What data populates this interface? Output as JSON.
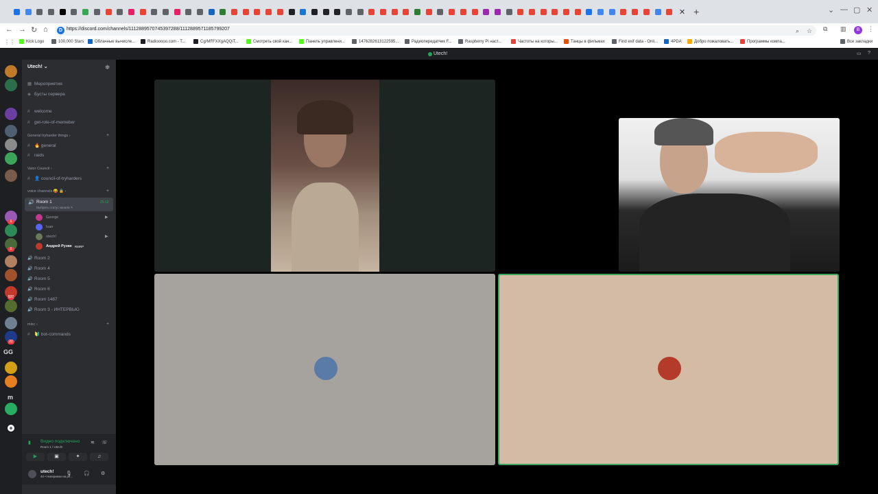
{
  "browser": {
    "url": "https://discord.com/channels/1112889570745397288/1112889571185799207",
    "omnibox_icon_letter": "D",
    "profile_letter": "B",
    "tab_icon_colors": [
      "#1a73e8",
      "#4285f4",
      "#5f6368",
      "#5f6368",
      "#000000",
      "#5f6368",
      "#34a853",
      "#5f6368",
      "#ea4335",
      "#5f6368",
      "#e91e63",
      "#ea4335",
      "#5f6368",
      "#5f6368",
      "#e91e63",
      "#5f6368",
      "#5f6368",
      "#1565c0",
      "#2e7d32",
      "#ea4335",
      "#ea4335",
      "#ea4335",
      "#ea4335",
      "#ea4335",
      "#202124",
      "#1976d2",
      "#202124",
      "#202124",
      "#202124",
      "#5f6368",
      "#5f6368",
      "#ea4335",
      "#ea4335",
      "#ea4335",
      "#ea4335",
      "#2e7d32",
      "#ea4335",
      "#5f6368",
      "#ea4335",
      "#ea4335",
      "#ea4335",
      "#9c27b0",
      "#9c27b0",
      "#5f6368",
      "#ea4335",
      "#ea4335",
      "#ea4335",
      "#ea4335",
      "#ea4335",
      "#ea4335",
      "#1a73e8",
      "#4285f4",
      "#4285f4",
      "#ea4335",
      "#ea4335",
      "#ea4335",
      "#4285f4",
      "#ea4335"
    ],
    "bookmarks": [
      {
        "label": "Kick Logo",
        "color": "#53fc18"
      },
      {
        "label": "100,000 Stars",
        "color": "#5f6368"
      },
      {
        "label": "Облачные вычисле...",
        "color": "#1565c0"
      },
      {
        "label": "Radiooooo.com - T...",
        "color": "#202124"
      },
      {
        "label": "Cg/MFFXXgAQQiT...",
        "color": "#202124"
      },
      {
        "label": "Смотреть свой кан...",
        "color": "#53fc18"
      },
      {
        "label": "Панель управлени...",
        "color": "#53fc18"
      },
      {
        "label": "1476282613122595...",
        "color": "#5f6368"
      },
      {
        "label": "Радиопередатчик F...",
        "color": "#5f6368"
      },
      {
        "label": "Raspberry Pi наст...",
        "color": "#5f6368"
      },
      {
        "label": "Частоты на которы...",
        "color": "#ea4335"
      },
      {
        "label": "Танцы в фильмах",
        "color": "#e65100"
      },
      {
        "label": "Find exif data - Onli...",
        "color": "#5f6368"
      },
      {
        "label": "4PDA",
        "color": "#1565c0"
      },
      {
        "label": "Добро пожаловать...",
        "color": "#f9ab00"
      },
      {
        "label": "Программы компа...",
        "color": "#ea4335"
      }
    ],
    "all_bookmarks_label": "Все закладки"
  },
  "discord": {
    "window_title": "Utech!",
    "server_name": "Utech!",
    "server_name_caret": "⌄",
    "servers": [
      {
        "color": "#c07a2a",
        "badge": ""
      },
      {
        "color": "#2c6e49",
        "badge": ""
      },
      {
        "color": "#6b3fa0",
        "badge": ""
      },
      {
        "color": "#506070",
        "badge": ""
      },
      {
        "color": "#8a8a8a",
        "badge": ""
      },
      {
        "color": "#3ba55c",
        "badge": ""
      },
      {
        "color": "#7a5a4a",
        "badge": ""
      },
      {
        "color": "#9b59b6",
        "badge": "6"
      },
      {
        "color": "#2e8b57",
        "badge": ""
      },
      {
        "color": "#4a6a3a",
        "badge": "6"
      },
      {
        "color": "#b08060",
        "badge": ""
      },
      {
        "color": "#a0522d",
        "badge": ""
      },
      {
        "color": "#c0392b",
        "badge": "537"
      },
      {
        "color": "#556b2f",
        "badge": ""
      },
      {
        "color": "#708090",
        "badge": ""
      },
      {
        "color": "#1e3a8a",
        "badge": "22"
      },
      {
        "color": "#d4a017",
        "badge": ""
      },
      {
        "color": "#e67e22",
        "badge": ""
      },
      {
        "color": "#27ae60",
        "badge": ""
      }
    ],
    "server_text_labels": [
      "GG",
      "m"
    ],
    "top_items": [
      "Мероприятия",
      "Бусты сервера"
    ],
    "channels": [
      {
        "name": "welcome"
      },
      {
        "name": "get-role-of-memeber"
      }
    ],
    "categories": [
      {
        "name": "General tryharder things",
        "channels": [
          "🔥 general",
          "raids"
        ]
      },
      {
        "name": "Valor Council",
        "channels": [
          "👤 council-of-tryharders"
        ]
      },
      {
        "name": "voice channels 😝 🔒",
        "channels": []
      },
      {
        "name": "misc",
        "channels": [
          "🔰 bot-commands"
        ]
      }
    ],
    "active_voice": {
      "name": "Room 1",
      "status": "Выбрать статус канала",
      "timer": "25:12",
      "members": [
        {
          "name": "George",
          "color": "#c0398c",
          "camera": true
        },
        {
          "name": "Ivan",
          "color": "#5865f2",
          "camera": false
        },
        {
          "name": "utech!",
          "color": "#6a7a5a",
          "camera": true
        },
        {
          "name": "Андрей Рузве",
          "color": "#c0392b",
          "camera": false,
          "tag": "RMRP"
        }
      ]
    },
    "voice_rooms": [
      "Room 2",
      "Room 4",
      "Room 5",
      "Room 6",
      "Room 1487",
      "Room 3 - ИНТЕРВЬЮ"
    ],
    "voice_panel": {
      "status": "Видео подключено",
      "sub": "Room 1 / Utech!"
    },
    "user": {
      "name": "utech!",
      "status": "40 • Нигеринки на ре..."
    },
    "tiles": {
      "tile3_avatar_color": "#5a7aa8",
      "tile4_avatar_color": "#b43a2a"
    }
  }
}
